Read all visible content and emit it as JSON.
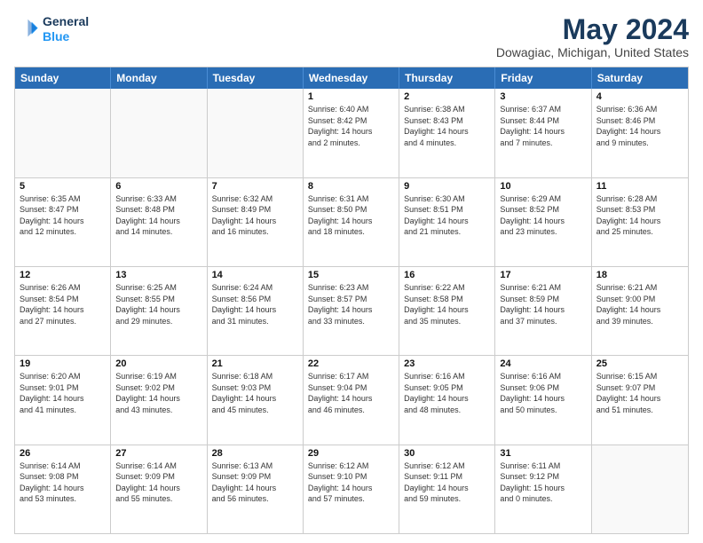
{
  "header": {
    "logo_line1": "General",
    "logo_line2": "Blue",
    "month_title": "May 2024",
    "location": "Dowagiac, Michigan, United States"
  },
  "weekdays": [
    "Sunday",
    "Monday",
    "Tuesday",
    "Wednesday",
    "Thursday",
    "Friday",
    "Saturday"
  ],
  "weeks": [
    [
      {
        "day": "",
        "info": "",
        "empty": true
      },
      {
        "day": "",
        "info": "",
        "empty": true
      },
      {
        "day": "",
        "info": "",
        "empty": true
      },
      {
        "day": "1",
        "info": "Sunrise: 6:40 AM\nSunset: 8:42 PM\nDaylight: 14 hours\nand 2 minutes.",
        "empty": false
      },
      {
        "day": "2",
        "info": "Sunrise: 6:38 AM\nSunset: 8:43 PM\nDaylight: 14 hours\nand 4 minutes.",
        "empty": false
      },
      {
        "day": "3",
        "info": "Sunrise: 6:37 AM\nSunset: 8:44 PM\nDaylight: 14 hours\nand 7 minutes.",
        "empty": false
      },
      {
        "day": "4",
        "info": "Sunrise: 6:36 AM\nSunset: 8:46 PM\nDaylight: 14 hours\nand 9 minutes.",
        "empty": false
      }
    ],
    [
      {
        "day": "5",
        "info": "Sunrise: 6:35 AM\nSunset: 8:47 PM\nDaylight: 14 hours\nand 12 minutes.",
        "empty": false
      },
      {
        "day": "6",
        "info": "Sunrise: 6:33 AM\nSunset: 8:48 PM\nDaylight: 14 hours\nand 14 minutes.",
        "empty": false
      },
      {
        "day": "7",
        "info": "Sunrise: 6:32 AM\nSunset: 8:49 PM\nDaylight: 14 hours\nand 16 minutes.",
        "empty": false
      },
      {
        "day": "8",
        "info": "Sunrise: 6:31 AM\nSunset: 8:50 PM\nDaylight: 14 hours\nand 18 minutes.",
        "empty": false
      },
      {
        "day": "9",
        "info": "Sunrise: 6:30 AM\nSunset: 8:51 PM\nDaylight: 14 hours\nand 21 minutes.",
        "empty": false
      },
      {
        "day": "10",
        "info": "Sunrise: 6:29 AM\nSunset: 8:52 PM\nDaylight: 14 hours\nand 23 minutes.",
        "empty": false
      },
      {
        "day": "11",
        "info": "Sunrise: 6:28 AM\nSunset: 8:53 PM\nDaylight: 14 hours\nand 25 minutes.",
        "empty": false
      }
    ],
    [
      {
        "day": "12",
        "info": "Sunrise: 6:26 AM\nSunset: 8:54 PM\nDaylight: 14 hours\nand 27 minutes.",
        "empty": false
      },
      {
        "day": "13",
        "info": "Sunrise: 6:25 AM\nSunset: 8:55 PM\nDaylight: 14 hours\nand 29 minutes.",
        "empty": false
      },
      {
        "day": "14",
        "info": "Sunrise: 6:24 AM\nSunset: 8:56 PM\nDaylight: 14 hours\nand 31 minutes.",
        "empty": false
      },
      {
        "day": "15",
        "info": "Sunrise: 6:23 AM\nSunset: 8:57 PM\nDaylight: 14 hours\nand 33 minutes.",
        "empty": false
      },
      {
        "day": "16",
        "info": "Sunrise: 6:22 AM\nSunset: 8:58 PM\nDaylight: 14 hours\nand 35 minutes.",
        "empty": false
      },
      {
        "day": "17",
        "info": "Sunrise: 6:21 AM\nSunset: 8:59 PM\nDaylight: 14 hours\nand 37 minutes.",
        "empty": false
      },
      {
        "day": "18",
        "info": "Sunrise: 6:21 AM\nSunset: 9:00 PM\nDaylight: 14 hours\nand 39 minutes.",
        "empty": false
      }
    ],
    [
      {
        "day": "19",
        "info": "Sunrise: 6:20 AM\nSunset: 9:01 PM\nDaylight: 14 hours\nand 41 minutes.",
        "empty": false
      },
      {
        "day": "20",
        "info": "Sunrise: 6:19 AM\nSunset: 9:02 PM\nDaylight: 14 hours\nand 43 minutes.",
        "empty": false
      },
      {
        "day": "21",
        "info": "Sunrise: 6:18 AM\nSunset: 9:03 PM\nDaylight: 14 hours\nand 45 minutes.",
        "empty": false
      },
      {
        "day": "22",
        "info": "Sunrise: 6:17 AM\nSunset: 9:04 PM\nDaylight: 14 hours\nand 46 minutes.",
        "empty": false
      },
      {
        "day": "23",
        "info": "Sunrise: 6:16 AM\nSunset: 9:05 PM\nDaylight: 14 hours\nand 48 minutes.",
        "empty": false
      },
      {
        "day": "24",
        "info": "Sunrise: 6:16 AM\nSunset: 9:06 PM\nDaylight: 14 hours\nand 50 minutes.",
        "empty": false
      },
      {
        "day": "25",
        "info": "Sunrise: 6:15 AM\nSunset: 9:07 PM\nDaylight: 14 hours\nand 51 minutes.",
        "empty": false
      }
    ],
    [
      {
        "day": "26",
        "info": "Sunrise: 6:14 AM\nSunset: 9:08 PM\nDaylight: 14 hours\nand 53 minutes.",
        "empty": false
      },
      {
        "day": "27",
        "info": "Sunrise: 6:14 AM\nSunset: 9:09 PM\nDaylight: 14 hours\nand 55 minutes.",
        "empty": false
      },
      {
        "day": "28",
        "info": "Sunrise: 6:13 AM\nSunset: 9:09 PM\nDaylight: 14 hours\nand 56 minutes.",
        "empty": false
      },
      {
        "day": "29",
        "info": "Sunrise: 6:12 AM\nSunset: 9:10 PM\nDaylight: 14 hours\nand 57 minutes.",
        "empty": false
      },
      {
        "day": "30",
        "info": "Sunrise: 6:12 AM\nSunset: 9:11 PM\nDaylight: 14 hours\nand 59 minutes.",
        "empty": false
      },
      {
        "day": "31",
        "info": "Sunrise: 6:11 AM\nSunset: 9:12 PM\nDaylight: 15 hours\nand 0 minutes.",
        "empty": false
      },
      {
        "day": "",
        "info": "",
        "empty": true
      }
    ]
  ]
}
